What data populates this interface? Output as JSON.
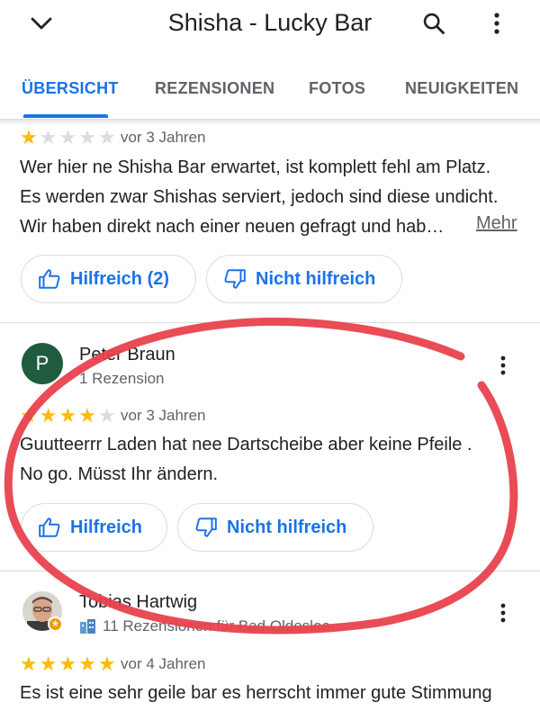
{
  "header": {
    "title": "Shisha - Lucky Bar",
    "back_icon": "chevron-down-icon",
    "search_icon": "search-icon",
    "menu_icon": "more-vert-icon"
  },
  "tabs": [
    {
      "label": "ÜBERSICHT",
      "active": true
    },
    {
      "label": "REZENSIONEN",
      "active": false
    },
    {
      "label": "FOTOS",
      "active": false
    },
    {
      "label": "NEUIGKEITEN",
      "active": false
    }
  ],
  "colors": {
    "accent": "#1a73e8",
    "star": "#fbbc04",
    "annotation": "#e8424d"
  },
  "reviews": [
    {
      "rating": 1,
      "time_ago": "vor 3 Jahren",
      "text_lines": [
        "Wer hier ne Shisha Bar erwartet, ist komplett fehl am Platz.",
        "Es werden zwar Shishas serviert, jedoch sind diese undicht.",
        "Wir haben direkt nach einer neuen gefragt und hab…"
      ],
      "more_label": "Mehr",
      "helpful_label": "Hilfreich (2)",
      "not_helpful_label": "Nicht hilfreich"
    },
    {
      "author": "Peter Braun",
      "avatar_initial": "P",
      "meta": "1 Rezension",
      "rating": 4,
      "time_ago": "vor 3 Jahren",
      "text_lines": [
        "Guutteerrr Laden hat nee Dartscheibe aber keine Pfeile .",
        "No go. Müsst  Ihr ändern."
      ],
      "helpful_label": "Hilfreich",
      "not_helpful_label": "Nicht hilfreich"
    },
    {
      "author": "Tobias Hartwig",
      "meta": "11 Rezensionen für Bad Oldesloe",
      "rating": 5,
      "time_ago": "vor 4 Jahren",
      "text_lines": [
        "Es ist eine sehr geile bar es herrscht immer gute Stimmung"
      ]
    }
  ]
}
